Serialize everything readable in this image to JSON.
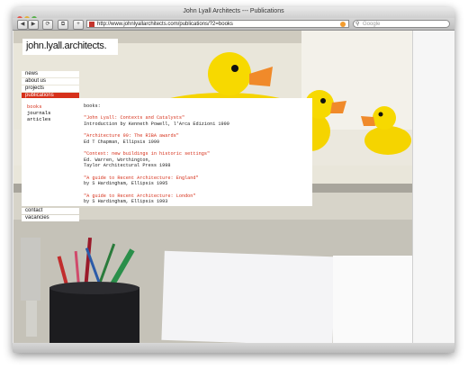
{
  "browser": {
    "title": "John Lyall Architects --- Publications",
    "url": "http://www.johnlyallarchitects.com/publications/?2=books",
    "search_placeholder": "Google",
    "buttons": {
      "back": "◀",
      "forward": "▶",
      "reload": "⟳",
      "bookmark": "⧉",
      "add": "+"
    }
  },
  "site": {
    "logo": "john.lyall.architects.",
    "nav_top": [
      "news",
      "about us",
      "projects",
      "publications"
    ],
    "nav_bottom": [
      "contact",
      "vacancies"
    ],
    "subnav": [
      "books",
      "journals",
      "articles"
    ],
    "section_heading": "books:",
    "publications": [
      {
        "title": "\"John Lyall: Contexts and Catalysts\"",
        "lines": [
          "Introduction by Kenneth Powell, l'Arca Edizioni 1999"
        ]
      },
      {
        "title": "\"Architecture 99: The RIBA awards\"",
        "lines": [
          "Ed T Chapman, Ellipsis 1999"
        ]
      },
      {
        "title": "\"Context: new buildings in historic settings\"",
        "lines": [
          "Ed. Warren, Worthington,",
          "Taylor Architectural Press 1998"
        ]
      },
      {
        "title": "\"A guide to Recent Architecture: England\"",
        "lines": [
          "by S Hardingham, Ellipsis 1995"
        ]
      },
      {
        "title": "\"A guide to Recent Architecture: London\"",
        "lines": [
          "by S Hardingham, Ellipsis 1993"
        ]
      }
    ]
  },
  "icons": {
    "window_buttons": [
      "close-icon",
      "minimize-icon",
      "zoom-icon"
    ],
    "toolbar": [
      "back-icon",
      "forward-icon",
      "reload-icon",
      "bookmark-icon",
      "add-icon",
      "rss-icon",
      "search-icon"
    ]
  }
}
